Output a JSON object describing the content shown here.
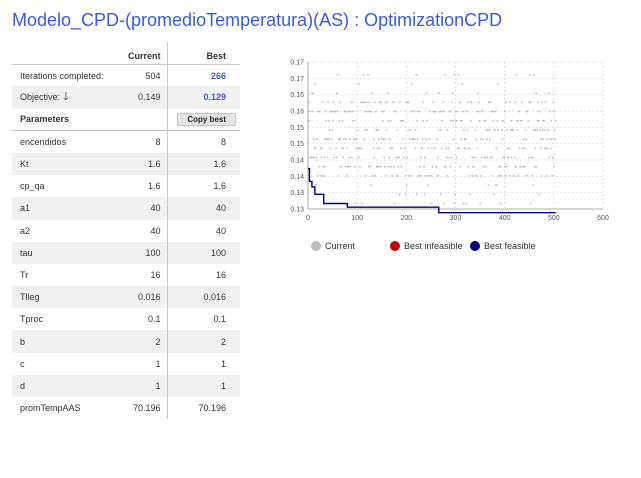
{
  "window": {
    "title": "Modelo_CPD-(promedioTemperatura)(AS) : OptimizationCPD"
  },
  "table": {
    "col_current": "Current",
    "col_best": "Best",
    "iterations_label": "Iterations completed:",
    "iterations_current": "504",
    "iterations_best": "266",
    "objective_label": "Objective:",
    "objective_arrow": "🡓",
    "objective_current": "0.149",
    "objective_best": "0.129",
    "parameters_label": "Parameters",
    "copy_best_label": "Copy best",
    "rows": [
      {
        "name": "encendidos",
        "current": "8",
        "best": "8"
      },
      {
        "name": "Kt",
        "current": "1.6",
        "best": "1.6"
      },
      {
        "name": "cp_qa",
        "current": "1.6",
        "best": "1.6"
      },
      {
        "name": "a1",
        "current": "40",
        "best": "40"
      },
      {
        "name": "a2",
        "current": "40",
        "best": "40"
      },
      {
        "name": "tau",
        "current": "100",
        "best": "100"
      },
      {
        "name": "Tr",
        "current": "16",
        "best": "16"
      },
      {
        "name": "Tlleg",
        "current": "0.016",
        "best": "0.016"
      },
      {
        "name": "Tproc",
        "current": "0.1",
        "best": "0.1"
      },
      {
        "name": "b",
        "current": "2",
        "best": "2"
      },
      {
        "name": "c",
        "current": "1",
        "best": "1"
      },
      {
        "name": "d",
        "current": "1",
        "best": "1"
      },
      {
        "name": "promTempAAS",
        "current": "70.196",
        "best": "70.196"
      }
    ]
  },
  "legend": {
    "current": "Current",
    "best_infeasible": "Best infeasible",
    "best_feasible": "Best feasible"
  },
  "colors": {
    "title": "#3b5bdb",
    "current": "#bdbdbd",
    "best_infeasible": "#c00000",
    "best_feasible": "#000080"
  },
  "chart_data": {
    "type": "scatter",
    "xlim": [
      0,
      600
    ],
    "ylim": [
      0.13,
      0.17
    ],
    "x_ticks": [
      "0",
      "100",
      "200",
      "300",
      "400",
      "500",
      "600"
    ],
    "y_ticks": [
      "0.13",
      "0.13",
      "0.14",
      "0.14",
      "0.15",
      "0.15",
      "0.16",
      "0.16",
      "0.17",
      "0.17"
    ],
    "grid": true,
    "current_points_count": 504,
    "best_feasible_step": {
      "x": [
        0,
        3,
        8,
        14,
        32,
        80,
        266,
        504
      ],
      "y": [
        0.141,
        0.1375,
        0.136,
        0.134,
        0.1315,
        0.1305,
        0.129,
        0.129
      ]
    }
  }
}
